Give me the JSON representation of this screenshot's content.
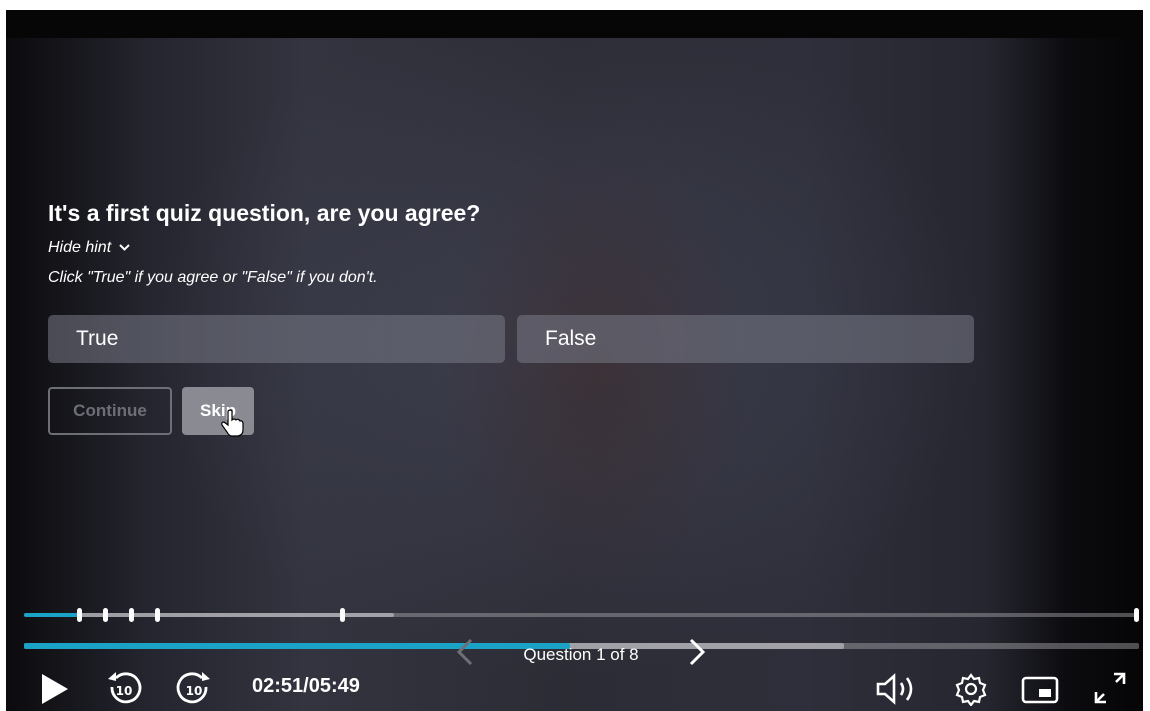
{
  "quiz": {
    "question": "It's a first quiz question, are you agree?",
    "hint_toggle": "Hide hint",
    "hint": "Click \"True\" if you agree or \"False\" if you don't.",
    "answers": [
      "True",
      "False"
    ],
    "continue_label": "Continue",
    "skip_label": "Skip"
  },
  "navigation": {
    "question_label": "Question 1 of 8"
  },
  "player": {
    "current_time": "02:51",
    "separator": "/",
    "duration": "05:49",
    "time_display": "02:51 / 05:49",
    "played_fraction": 0.49,
    "rewind_seconds": "10",
    "forward_seconds": "10"
  },
  "colors": {
    "accent": "#1aa3c7",
    "text": "#ffffff"
  },
  "icons": [
    "play-icon",
    "rewind-10-icon",
    "forward-10-icon",
    "volume-icon",
    "settings-gear-icon",
    "picture-in-picture-icon",
    "fullscreen-icon",
    "hand-pointer-cursor-icon"
  ]
}
